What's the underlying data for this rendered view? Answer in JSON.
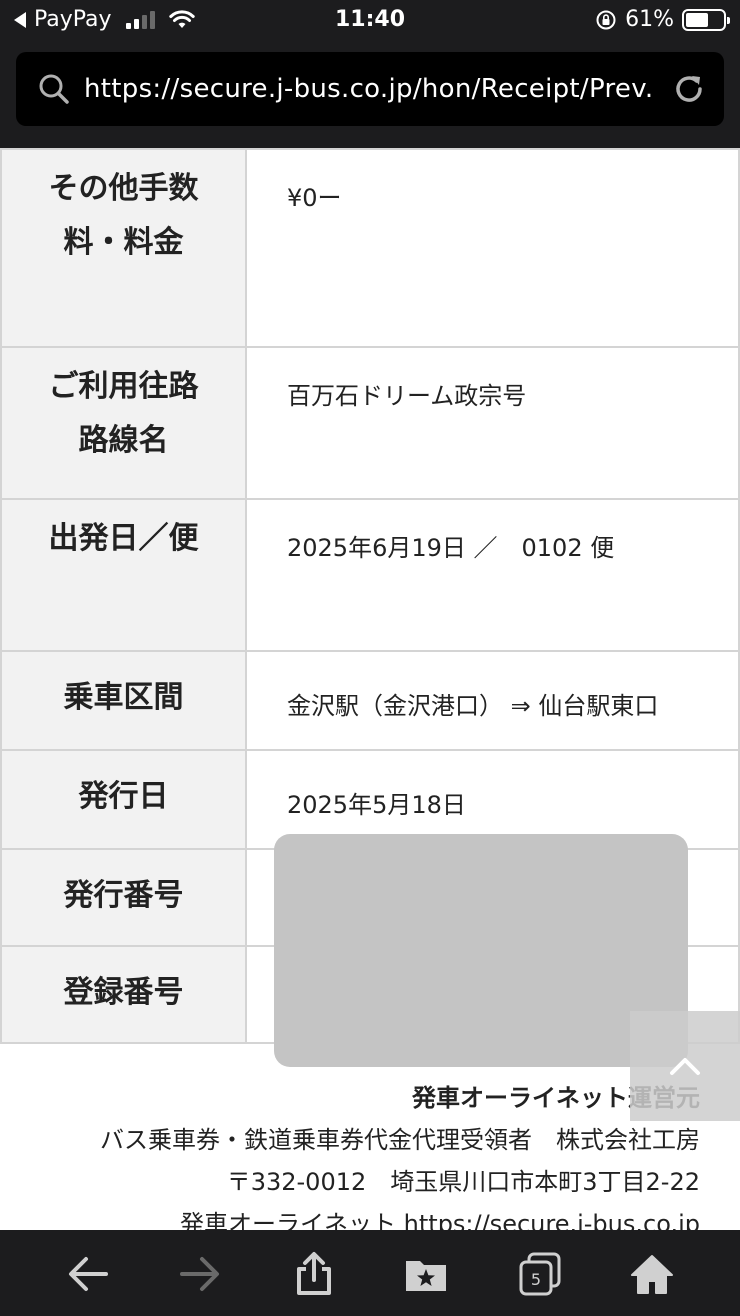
{
  "status_bar": {
    "back_app": "PayPay",
    "time": "11:40",
    "battery": "61%",
    "battery_level": 0.61
  },
  "browser": {
    "url": "https://secure.j-bus.co.jp/hon/Receipt/Prev..."
  },
  "receipt": {
    "rows": [
      {
        "label": "その他手数料・料金",
        "value": "¥0ー"
      },
      {
        "label": "ご利用往路路線名",
        "value": "百万石ドリーム政宗号"
      },
      {
        "label": "出発日／便",
        "value": "2025年6月19日 ／　0102 便"
      },
      {
        "label": "乗車区間",
        "value": "金沢駅（金沢港口） ⇒ 仙台駅東口"
      },
      {
        "label": "発行日",
        "value": "2025年5月18日"
      },
      {
        "label": "発行番号",
        "value": ""
      },
      {
        "label": "登録番号",
        "value": ""
      }
    ]
  },
  "footer": {
    "operator": "発車オーライネット運営元",
    "company": "バス乗車券・鉄道乗車券代金代理受領者　株式会社工房",
    "address": "〒332-0012　埼玉県川口市本町3丁目2-22",
    "site": "発車オーライネット https://secure.j-bus.co.jp"
  },
  "toolbar": {
    "tab_count": "5"
  }
}
